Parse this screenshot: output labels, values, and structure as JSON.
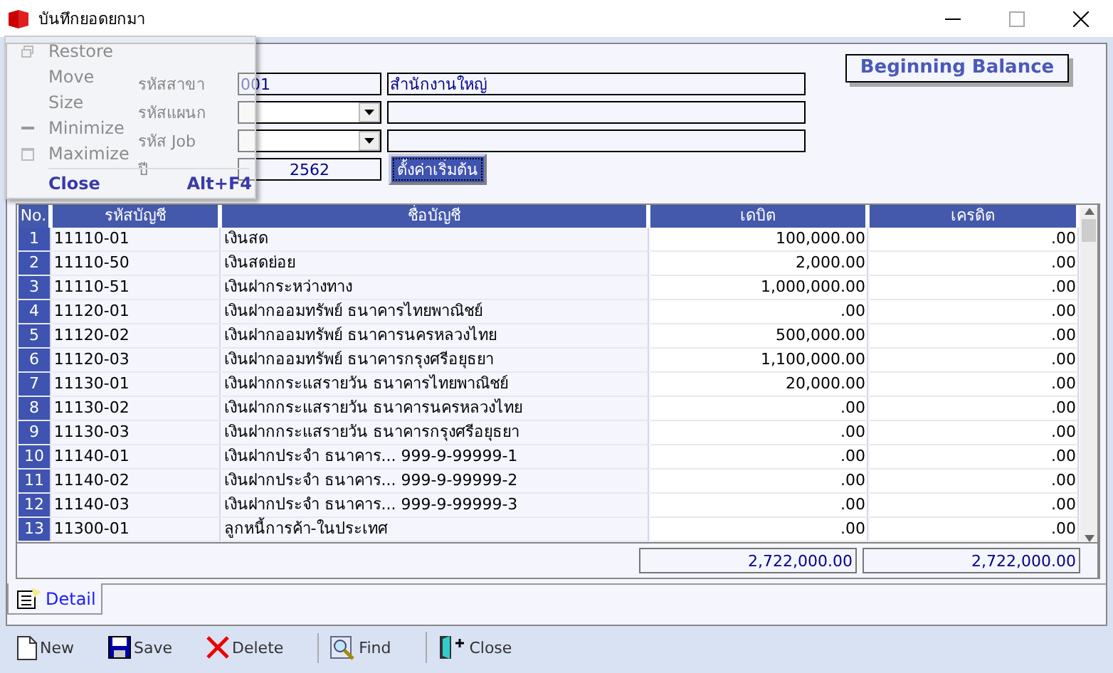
{
  "window": {
    "title": "บันทึกยอดยกมา"
  },
  "system_menu": [
    {
      "label": "Restore",
      "kind": "restore",
      "disabled": true
    },
    {
      "label": "Move",
      "kind": "plain",
      "disabled": true
    },
    {
      "label": "Size",
      "kind": "plain",
      "disabled": true
    },
    {
      "label": "Minimize",
      "kind": "minimize",
      "disabled": true
    },
    {
      "label": "Maximize",
      "kind": "maximize",
      "disabled": true
    },
    {
      "label": "Close",
      "kind": "plain",
      "shortcut": "Alt+F4",
      "disabled": false
    }
  ],
  "heading": "Beginning Balance",
  "form": {
    "fields": [
      {
        "label": "รหัสสาขา",
        "kind": "text",
        "value": "001",
        "description": "สำนักงานใหญ่"
      },
      {
        "label": "รหัสแผนก",
        "kind": "dropdown"
      },
      {
        "label": "รหัส Job",
        "kind": "dropdown"
      }
    ],
    "year": {
      "label": "ปี",
      "value": "2562"
    },
    "default_button": "ตั้งค่าเริ่มต้น"
  },
  "table": {
    "columns": [
      "No.",
      "รหัสบัญชี",
      "ชื่อบัญชี",
      "เดบิต",
      "เครดิต"
    ],
    "rows": [
      [
        "1",
        "11110-01",
        "เงินสด",
        "100,000.00",
        ".00"
      ],
      [
        "2",
        "11110-50",
        "เงินสดย่อย",
        "2,000.00",
        ".00"
      ],
      [
        "3",
        "11110-51",
        "เงินฝากระหว่างทาง",
        "1,000,000.00",
        ".00"
      ],
      [
        "4",
        "11120-01",
        "เงินฝากออมทรัพย์ ธนาคารไทยพาณิชย์",
        ".00",
        ".00"
      ],
      [
        "5",
        "11120-02",
        "เงินฝากออมทรัพย์ ธนาคารนครหลวงไทย",
        "500,000.00",
        ".00"
      ],
      [
        "6",
        "11120-03",
        "เงินฝากออมทรัพย์ ธนาคารกรุงศรีอยุธยา",
        "1,100,000.00",
        ".00"
      ],
      [
        "7",
        "11130-01",
        "เงินฝากกระแสรายวัน ธนาคารไทยพาณิชย์",
        "20,000.00",
        ".00"
      ],
      [
        "8",
        "11130-02",
        "เงินฝากกระแสรายวัน ธนาคารนครหลวงไทย",
        ".00",
        ".00"
      ],
      [
        "9",
        "11130-03",
        "เงินฝากกระแสรายวัน ธนาคารกรุงศรีอยุธยา",
        ".00",
        ".00"
      ],
      [
        "10",
        "11140-01",
        "เงินฝากประจำ ธนาคาร... 999-9-99999-1",
        ".00",
        ".00"
      ],
      [
        "11",
        "11140-02",
        "เงินฝากประจำ ธนาคาร... 999-9-99999-2",
        ".00",
        ".00"
      ],
      [
        "12",
        "11140-03",
        "เงินฝากประจำ ธนาคาร... 999-9-99999-3",
        ".00",
        ".00"
      ],
      [
        "13",
        "11300-01",
        "ลูกหนี้การค้า-ในประเทศ",
        ".00",
        ".00"
      ]
    ],
    "totals": {
      "debit": "2,722,000.00",
      "credit": "2,722,000.00"
    }
  },
  "tabs": [
    {
      "label": "Detail",
      "selected": true
    }
  ],
  "toolbar": [
    [
      {
        "label": "New",
        "kind": "new"
      },
      {
        "label": "Save",
        "kind": "save"
      },
      {
        "label": "Delete",
        "kind": "delete"
      }
    ],
    [
      {
        "label": "Find",
        "kind": "find"
      }
    ],
    [
      {
        "label": "Close",
        "kind": "close"
      }
    ]
  ]
}
